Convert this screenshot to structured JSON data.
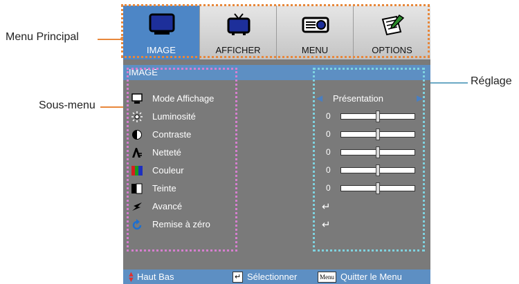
{
  "callouts": {
    "menu_principal": "Menu Principal",
    "sous_menu": "Sous-menu",
    "reglage": "Réglage"
  },
  "tabs": [
    {
      "label": "IMAGE",
      "icon": "monitor-icon",
      "active": true
    },
    {
      "label": "AFFICHER",
      "icon": "tv-icon",
      "active": false
    },
    {
      "label": "MENU",
      "icon": "projector-icon",
      "active": false
    },
    {
      "label": "OPTIONS",
      "icon": "notepad-pencil-icon",
      "active": false
    }
  ],
  "submenu_title": "IMAGE",
  "rows": [
    {
      "label": "Mode Affichage",
      "icon": "monitor-small-icon",
      "kind": "select",
      "value": "Présentation"
    },
    {
      "label": "Luminosité",
      "icon": "brightness-icon",
      "kind": "slider",
      "value": "0",
      "level": 0.5
    },
    {
      "label": "Contraste",
      "icon": "contrast-icon",
      "kind": "slider",
      "value": "0",
      "level": 0.5
    },
    {
      "label": "Netteté",
      "icon": "sharpness-icon",
      "kind": "slider",
      "value": "0",
      "level": 0.5
    },
    {
      "label": "Couleur",
      "icon": "color-icon",
      "kind": "slider",
      "value": "0",
      "level": 0.5
    },
    {
      "label": "Teinte",
      "icon": "tint-icon",
      "kind": "slider",
      "value": "0",
      "level": 0.5
    },
    {
      "label": "Avancé",
      "icon": "advanced-icon",
      "kind": "enter"
    },
    {
      "label": "Remise à zéro",
      "icon": "reset-icon",
      "kind": "enter"
    }
  ],
  "footer": {
    "nav_label": "Haut Bas",
    "select_label": "Sélectionner",
    "menu_key": "Menu",
    "quit_label": "Quitter le Menu"
  },
  "colors": {
    "osd_bg": "#7a7a7a",
    "accent": "#5d8fc3",
    "callout_orange": "#e8873a",
    "callout_pink": "#d77fd0",
    "callout_cyan": "#7fd3e0"
  }
}
